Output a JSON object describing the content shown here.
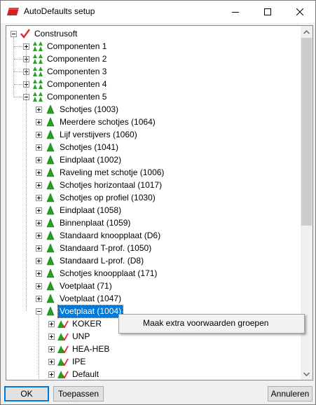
{
  "window": {
    "title": "AutoDefaults setup"
  },
  "tree": {
    "root": "Construsoft",
    "groups": [
      "Componenten 1",
      "Componenten 2",
      "Componenten 3",
      "Componenten 4",
      "Componenten 5"
    ],
    "components": [
      "Schotjes (1003)",
      "Meerdere schotjes (1064)",
      "Lijf verstijvers (1060)",
      "Schotjes (1041)",
      "Eindplaat (1002)",
      "Raveling met schotje (1006)",
      "Schotjes horizontaal (1017)",
      "Schotjes op profiel (1030)",
      "Eindplaat (1058)",
      "Binnenplaat (1059)",
      "Standaard knoopplaat (D6)",
      "Standaard T-prof. (1050)",
      "Standaard L-prof. (D8)",
      "Schotjes knoopplaat (171)",
      "Voetplaat (71)",
      "Voetplaat (1047)",
      "Voetplaat (1004)"
    ],
    "selected": "Voetplaat (1004)",
    "rules": [
      "KOKER",
      "UNP",
      "HEA-HEB",
      "IPE",
      "Default"
    ]
  },
  "context_menu": {
    "item": "Maak extra voorwaarden groepen"
  },
  "buttons": {
    "ok": "OK",
    "apply": "Toepassen",
    "cancel": "Annuleren"
  }
}
